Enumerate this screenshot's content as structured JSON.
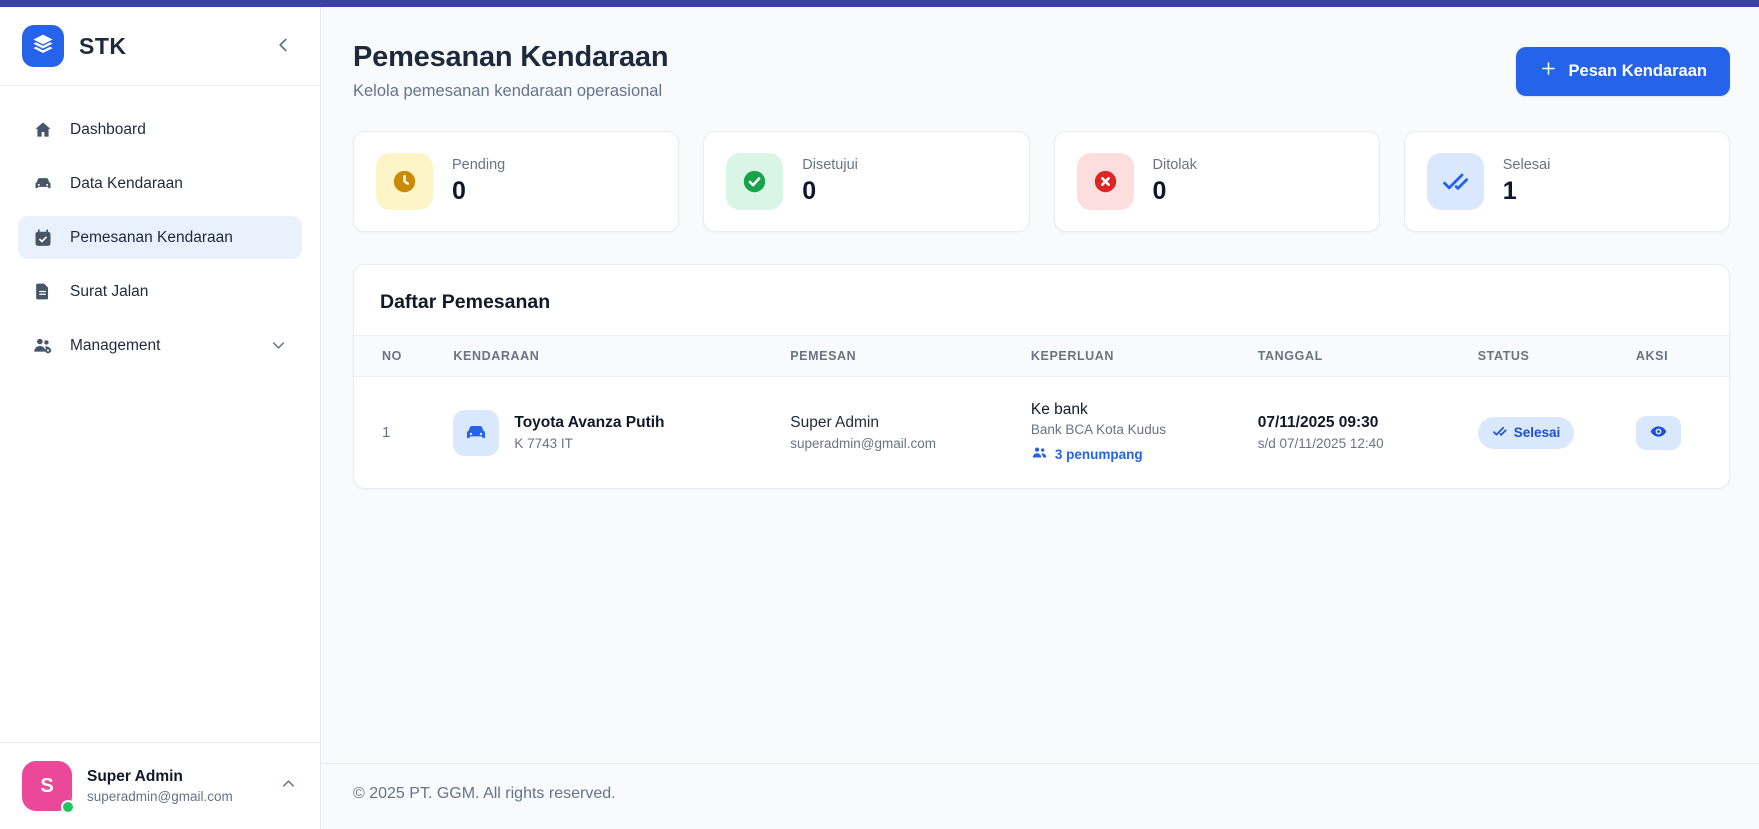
{
  "colors": {
    "topbar": "#3b3fa8",
    "accent": "#2563eb",
    "pending_icon": "#ca8a04",
    "approved_icon": "#16a34a",
    "rejected_icon": "#dc2626",
    "done_icon": "#2563eb",
    "avatar_bg": "#ec4899",
    "online_dot": "#22c55e"
  },
  "sidebar": {
    "logo_text": "STK",
    "items": [
      {
        "label": "Dashboard",
        "icon": "home-icon",
        "active": false
      },
      {
        "label": "Data Kendaraan",
        "icon": "car-icon",
        "active": false
      },
      {
        "label": "Pemesanan Kendaraan",
        "icon": "calendar-check-icon",
        "active": true
      },
      {
        "label": "Surat Jalan",
        "icon": "file-text-icon",
        "active": false
      },
      {
        "label": "Management",
        "icon": "users-gear-icon",
        "active": false,
        "expandable": true
      }
    ],
    "profile": {
      "initial": "S",
      "name": "Super Admin",
      "email": "superadmin@gmail.com",
      "status": "online"
    }
  },
  "header": {
    "title": "Pemesanan Kendaraan",
    "subtitle": "Kelola pemesanan kendaraan operasional",
    "action_label": "Pesan Kendaraan"
  },
  "stats": [
    {
      "label": "Pending",
      "value": "0",
      "icon": "clock-icon"
    },
    {
      "label": "Disetujui",
      "value": "0",
      "icon": "check-circle-icon"
    },
    {
      "label": "Ditolak",
      "value": "0",
      "icon": "x-circle-icon"
    },
    {
      "label": "Selesai",
      "value": "1",
      "icon": "double-check-icon"
    }
  ],
  "table": {
    "title": "Daftar Pemesanan",
    "columns": [
      "NO",
      "KENDARAAN",
      "PEMESAN",
      "KEPERLUAN",
      "TANGGAL",
      "STATUS",
      "AKSI"
    ],
    "rows": [
      {
        "no": "1",
        "vehicle_name": "Toyota Avanza Putih",
        "vehicle_plate": "K 7743 IT",
        "requester_name": "Super Admin",
        "requester_email": "superadmin@gmail.com",
        "purpose": "Ke bank",
        "destination": "Bank BCA Kota Kudus",
        "passengers": "3 penumpang",
        "date_start": "07/11/2025 09:30",
        "date_end": "s/d 07/11/2025 12:40",
        "status": "Selesai"
      }
    ]
  },
  "footer": {
    "copyright": "© 2025 PT. GGM. All rights reserved."
  }
}
